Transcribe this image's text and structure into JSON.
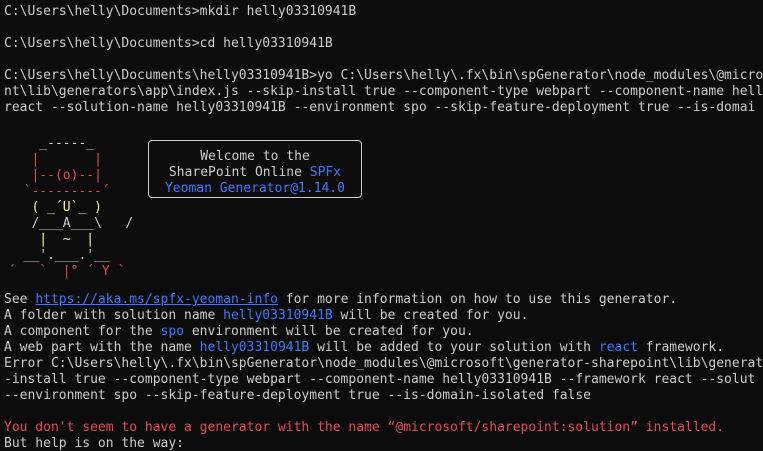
{
  "terminal": {
    "lines": {
      "l1": "C:\\Users\\helly\\Documents>mkdir helly03310941B",
      "l2": "C:\\Users\\helly\\Documents>cd helly03310941B",
      "l3": "C:\\Users\\helly\\Documents\\helly03310941B>yo C:\\Users\\helly\\.fx\\bin\\spGenerator\\node_modules\\@micros",
      "l4": "nt\\lib\\generators\\app\\index.js --skip-install true --component-type webpart --component-name hell",
      "l5": "react --solution-name helly03310941B --environment spo --skip-feature-deployment true --is-domai"
    },
    "welcome": {
      "line1": "Welcome to the",
      "line2_prefix": "SharePoint Online ",
      "line2_accent": "SPFx",
      "line3": "Yeoman Generator@1.14.0"
    },
    "ascii": {
      "r1": "    _-----_",
      "r2": "   |       |",
      "r3": "   |--(o)--|",
      "r4": "  `---------´",
      "r5": "   ( _´U`_ )",
      "r6": "   /___A___\\   /",
      "r7": "    |  ~  |",
      "r8": "  __'.___.'__",
      "r9": "´   `  |° ´ Y `"
    },
    "info": {
      "see_prefix": "See ",
      "see_link": "https://aka.ms/spfx-yeoman-info",
      "see_suffix": " for more information on how to use this generator.",
      "folder_prefix": "A folder with solution name ",
      "folder_name": "helly03310941B",
      "folder_suffix": " will be created for you.",
      "component_prefix": "A component for the ",
      "component_env": "spo",
      "component_suffix": " environment will be created for you.",
      "webpart_prefix": "A web part with the name ",
      "webpart_name": "helly03310941B",
      "webpart_mid": " will be added to your solution with ",
      "webpart_framework": "react",
      "webpart_suffix": " framework."
    },
    "error": {
      "e1": "Error C:\\Users\\helly\\.fx\\bin\\spGenerator\\node_modules\\@microsoft\\generator-sharepoint\\lib\\generat",
      "e2": "-install true --component-type webpart --component-name helly03310941B --framework react --solut",
      "e3": "--environment spo --skip-feature-deployment true --is-domain-isolated false",
      "no_generator": "You don't seem to have a generator with the name “@microsoft/sharepoint:solution” installed.",
      "help": "But help is on the way:"
    },
    "colors": {
      "background": "#0c0c0c",
      "text": "#cccccc",
      "accent_blue": "#3b78ff",
      "error_red": "#e74856",
      "yellow": "#f9f1a5"
    }
  }
}
